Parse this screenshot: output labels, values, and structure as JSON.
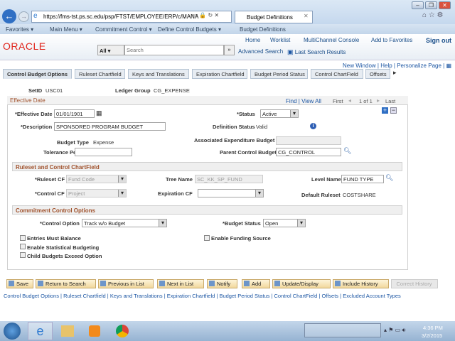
{
  "browser": {
    "url": "https://fms-tst.ps.sc.edu/psp/FTST/EMPLOYEE/ERP/c/MANA",
    "tab_title": "Budget Definitions"
  },
  "nav": {
    "favorites": "Favorites ▾",
    "main_menu": "Main Menu ▾",
    "crumbs": [
      "Commitment Control ▾",
      "Define Control Budgets ▾",
      "Budget Definitions"
    ],
    "sep": "›"
  },
  "header": {
    "logo": "ORACLE",
    "links": [
      "Home",
      "Worklist",
      "MultiChannel Console",
      "Add to Favorites",
      "Sign out"
    ],
    "search_scope": "All",
    "search_placeholder": "Search",
    "advanced_search": "Advanced Search",
    "last_search": "Last Search Results"
  },
  "page_links": {
    "new_window": "New Window",
    "help": "Help",
    "personalize": "Personalize Page"
  },
  "tabs": [
    "Control Budget Options",
    "Ruleset Chartfield",
    "Keys and Translations",
    "Expiration Chartfield",
    "Budget Period Status",
    "Control ChartField",
    "Offsets"
  ],
  "keys": {
    "setid_label": "SetID",
    "setid": "USC01",
    "ledger_label": "Ledger Group",
    "ledger": "CG_EXPENSE"
  },
  "effdt": {
    "title": "Effective Date",
    "find": "Find",
    "view_all": "View All",
    "first": "First",
    "count": "1 of 1",
    "last": "Last",
    "eff_label": "*Effective Date",
    "eff": "01/01/1901",
    "status_label": "*Status",
    "status": "Active",
    "desc_label": "*Description",
    "desc": "SPONSORED PROGRAM BUDGET",
    "defstatus_label": "Definition Status",
    "defstatus": "Valid",
    "btype_label": "Budget Type",
    "btype": "Expense",
    "assoc_label": "Associated Expenditure Budget",
    "assoc": "",
    "tol_label": "Tolerance Percent",
    "tol": "",
    "parent_label": "Parent Control Budget",
    "parent": "CG_CONTROL"
  },
  "ruleset": {
    "title": "Ruleset and Control ChartField",
    "rcf_label": "*Ruleset CF",
    "rcf": "Fund Code",
    "tree_label": "Tree Name",
    "tree": "SC_KK_SP_FUND",
    "level_label": "Level Name",
    "level": "FUND TYPE",
    "ccf_label": "*Control CF",
    "ccf": "Project",
    "exp_label": "Expiration CF",
    "exp": "",
    "def_label": "Default Ruleset",
    "def": "COSTSHARE"
  },
  "cc": {
    "title": "Commitment Control Options",
    "opt_label": "*Control Option",
    "opt": "Track w/o Budget",
    "bstat_label": "*Budget Status",
    "bstat": "Open",
    "checks": [
      {
        "label": "Entries Must Balance",
        "checked": false
      },
      {
        "label": "Enable Statistical Budgeting",
        "checked": false
      },
      {
        "label": "Child Budgets Exceed Option",
        "checked": false
      },
      {
        "label": "Enable Funding Source",
        "checked": false
      }
    ]
  },
  "buttons": [
    "Save",
    "Return to Search",
    "Previous in List",
    "Next in List",
    "Notify",
    "Add",
    "Update/Display",
    "Include History",
    "Correct History"
  ],
  "footer_links": [
    "Control Budget Options",
    "Ruleset Chartfield",
    "Keys and Translations",
    "Expiration Chartfield",
    "Budget Period Status",
    "Control ChartField",
    "Offsets",
    "Excluded Account Types"
  ],
  "taskbar": {
    "time": "4:36 PM",
    "date": "3/2/2015"
  }
}
